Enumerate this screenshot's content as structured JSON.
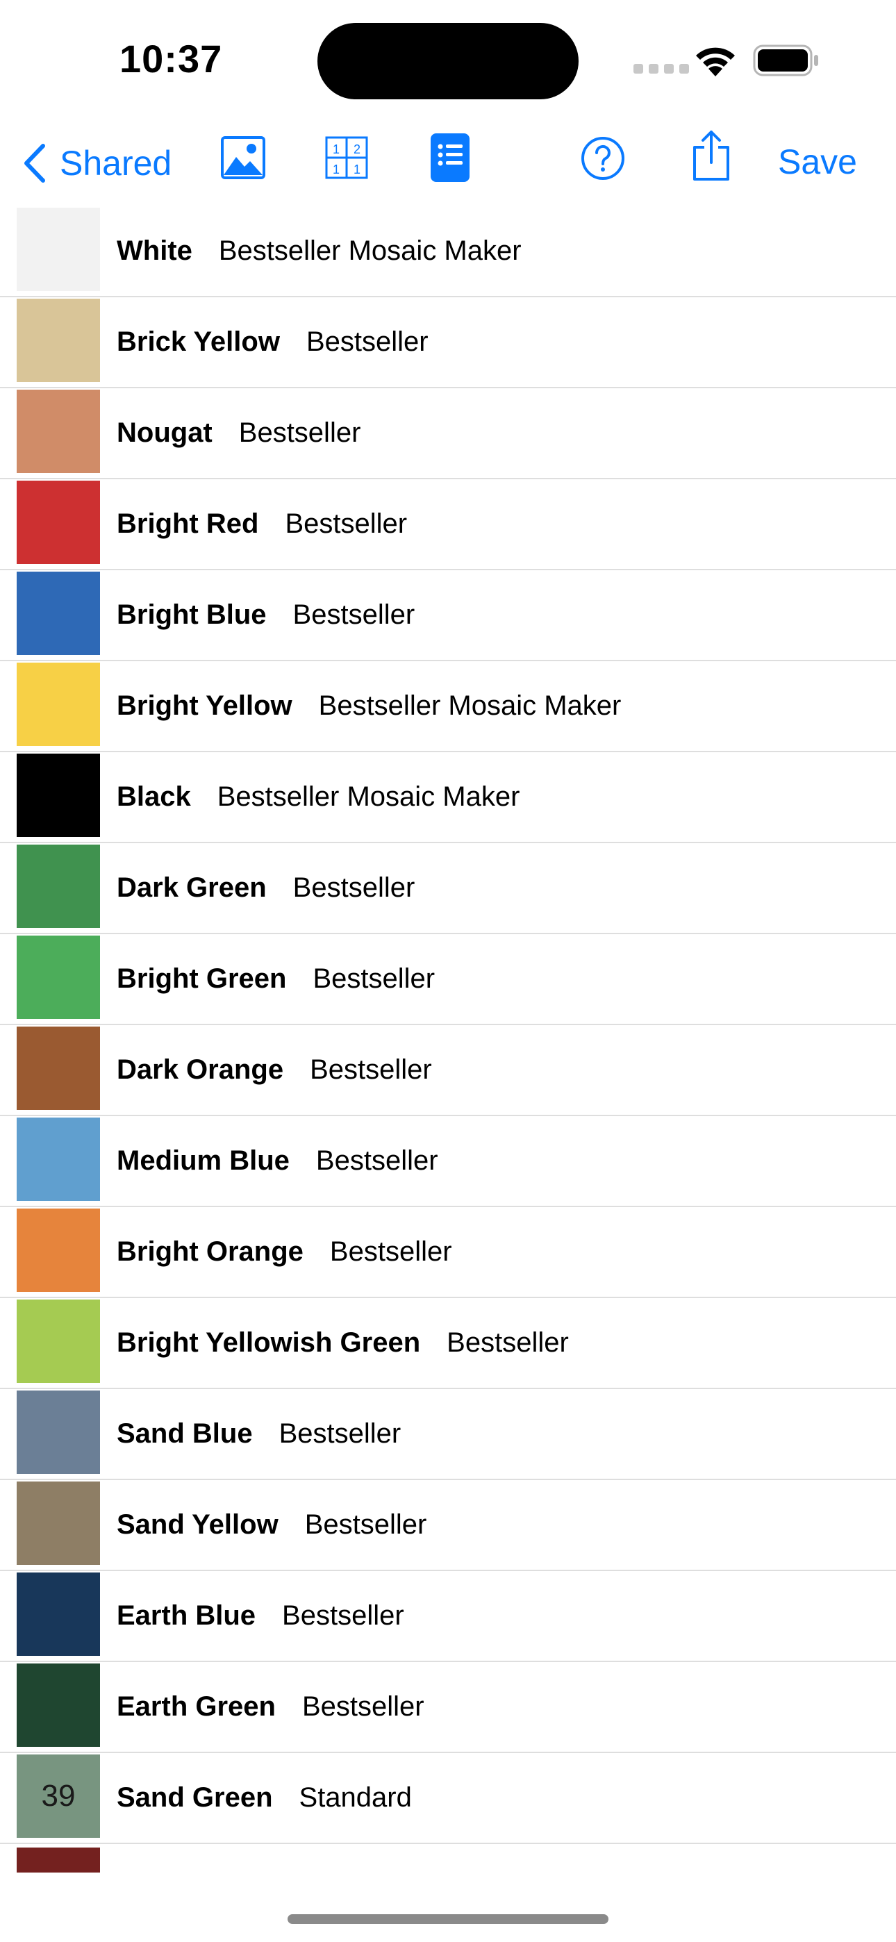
{
  "status_bar": {
    "time": "10:37"
  },
  "toolbar": {
    "back_label": "Shared",
    "save_label": "Save",
    "accent_color": "#0a7aff",
    "icons": [
      "photo-icon",
      "grid-numbers-icon",
      "list-icon",
      "help-icon",
      "share-icon"
    ],
    "grid_digits": [
      "1",
      "2",
      "1",
      "1"
    ]
  },
  "colors": [
    {
      "name": "White",
      "tags": "Bestseller Mosaic Maker",
      "swatch": "#f2f2f2",
      "count": ""
    },
    {
      "name": "Brick Yellow",
      "tags": "Bestseller",
      "swatch": "#d9c598",
      "count": ""
    },
    {
      "name": "Nougat",
      "tags": "Bestseller",
      "swatch": "#d08c68",
      "count": ""
    },
    {
      "name": "Bright Red",
      "tags": "Bestseller",
      "swatch": "#cd3031",
      "count": ""
    },
    {
      "name": "Bright Blue",
      "tags": "Bestseller",
      "swatch": "#2e69b6",
      "count": ""
    },
    {
      "name": "Bright Yellow",
      "tags": "Bestseller Mosaic Maker",
      "swatch": "#f7d046",
      "count": ""
    },
    {
      "name": "Black",
      "tags": "Bestseller Mosaic Maker",
      "swatch": "#000000",
      "count": ""
    },
    {
      "name": "Dark Green",
      "tags": "Bestseller",
      "swatch": "#40924f",
      "count": ""
    },
    {
      "name": "Bright Green",
      "tags": "Bestseller",
      "swatch": "#4cad5a",
      "count": ""
    },
    {
      "name": "Dark Orange",
      "tags": "Bestseller",
      "swatch": "#9a5a31",
      "count": ""
    },
    {
      "name": "Medium Blue",
      "tags": "Bestseller",
      "swatch": "#609fcf",
      "count": ""
    },
    {
      "name": "Bright Orange",
      "tags": "Bestseller",
      "swatch": "#e6843c",
      "count": ""
    },
    {
      "name": "Bright Yellowish Green",
      "tags": "Bestseller",
      "swatch": "#a5cb52",
      "count": ""
    },
    {
      "name": "Sand Blue",
      "tags": "Bestseller",
      "swatch": "#6b7f96",
      "count": ""
    },
    {
      "name": "Sand Yellow",
      "tags": "Bestseller",
      "swatch": "#8e7e65",
      "count": ""
    },
    {
      "name": "Earth Blue",
      "tags": "Bestseller",
      "swatch": "#18375a",
      "count": ""
    },
    {
      "name": "Earth Green",
      "tags": "Bestseller",
      "swatch": "#1f4630",
      "count": ""
    },
    {
      "name": "Sand Green",
      "tags": "Standard",
      "swatch": "#789580",
      "count": "39"
    }
  ],
  "partial_row_swatch": "#74211f"
}
